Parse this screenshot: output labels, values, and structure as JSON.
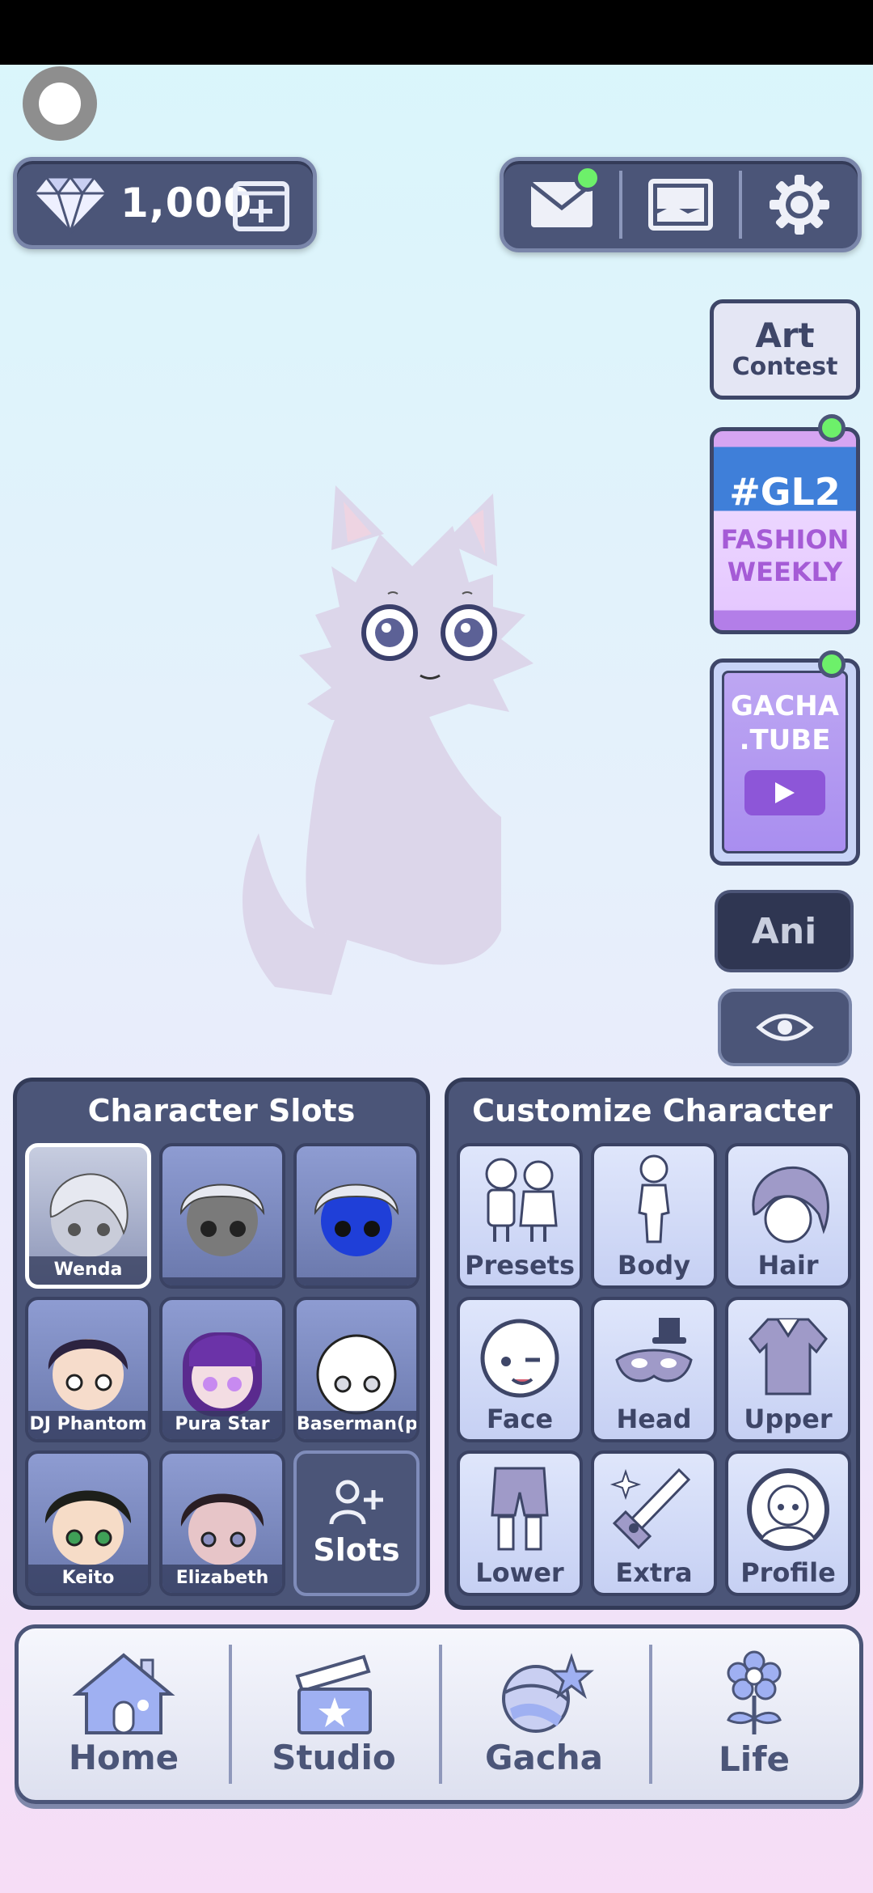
{
  "header": {
    "gem_count": "1,000"
  },
  "side": {
    "art_contest": {
      "line1": "Art",
      "line2": "Contest"
    },
    "gl2": {
      "tag": "#GL2",
      "line1": "FASHION",
      "line2": "WEEKLY"
    },
    "tube": {
      "line1": "GACHA",
      "line2": ".TUBE"
    },
    "ani_label": "Ani"
  },
  "slots": {
    "title": "Character Slots",
    "items": [
      {
        "name": "Wenda"
      },
      {
        "name": ""
      },
      {
        "name": ""
      },
      {
        "name": "DJ Phantom"
      },
      {
        "name": "Pura Star"
      },
      {
        "name": "Baserman(plu"
      },
      {
        "name": "Keito"
      },
      {
        "name": "Elizabeth"
      }
    ],
    "add_label": "Slots"
  },
  "customize": {
    "title": "Customize Character",
    "items": [
      {
        "label": "Presets",
        "icon": "presets-icon"
      },
      {
        "label": "Body",
        "icon": "body-icon"
      },
      {
        "label": "Hair",
        "icon": "hair-icon"
      },
      {
        "label": "Face",
        "icon": "face-icon"
      },
      {
        "label": "Head",
        "icon": "head-icon"
      },
      {
        "label": "Upper",
        "icon": "upper-icon"
      },
      {
        "label": "Lower",
        "icon": "lower-icon"
      },
      {
        "label": "Extra",
        "icon": "extra-icon"
      },
      {
        "label": "Profile",
        "icon": "profile-icon"
      }
    ]
  },
  "nav": {
    "items": [
      {
        "label": "Home",
        "icon": "home-icon"
      },
      {
        "label": "Studio",
        "icon": "studio-icon"
      },
      {
        "label": "Gacha",
        "icon": "gacha-icon"
      },
      {
        "label": "Life",
        "icon": "life-icon"
      }
    ]
  },
  "colors": {
    "panel": "#4b5578",
    "accent_green": "#6df06a",
    "text_dark": "#4b5578"
  }
}
